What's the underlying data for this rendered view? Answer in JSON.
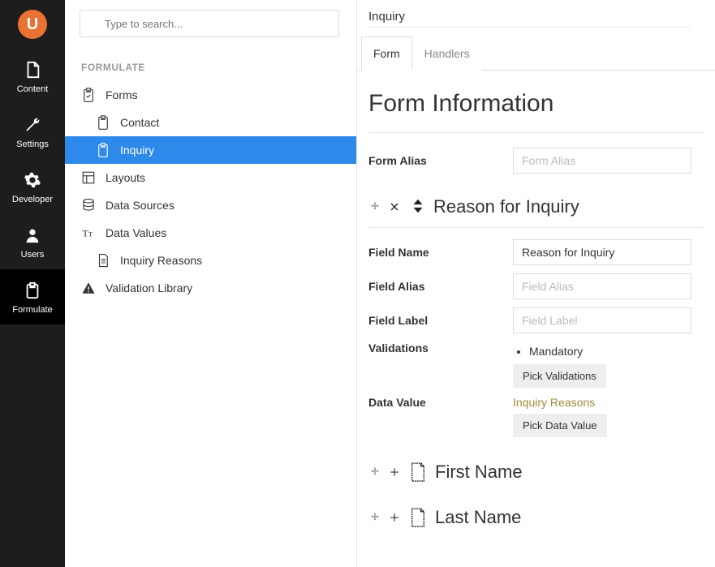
{
  "sidebar": {
    "items": [
      {
        "label": "Content"
      },
      {
        "label": "Settings"
      },
      {
        "label": "Developer"
      },
      {
        "label": "Users"
      },
      {
        "label": "Formulate"
      }
    ]
  },
  "search": {
    "placeholder": "Type to search..."
  },
  "tree": {
    "header": "FORMULATE",
    "forms": "Forms",
    "contact": "Contact",
    "inquiry": "Inquiry",
    "layouts": "Layouts",
    "data_sources": "Data Sources",
    "data_values": "Data Values",
    "inquiry_reasons": "Inquiry Reasons",
    "validation_library": "Validation Library"
  },
  "main": {
    "title_value": "Inquiry",
    "tabs": {
      "form": "Form",
      "handlers": "Handlers"
    },
    "section_title": "Form Information",
    "form_alias_label": "Form Alias",
    "form_alias_placeholder": "Form Alias",
    "block1": {
      "title": "Reason for Inquiry",
      "field_name_label": "Field Name",
      "field_name_value": "Reason for Inquiry",
      "field_alias_label": "Field Alias",
      "field_alias_placeholder": "Field Alias",
      "field_label_label": "Field Label",
      "field_label_placeholder": "Field Label",
      "validations_label": "Validations",
      "validation_item": "Mandatory",
      "pick_validations": "Pick Validations",
      "data_value_label": "Data Value",
      "data_value_text": "Inquiry Reasons",
      "pick_data_value": "Pick Data Value"
    },
    "block2": {
      "title": "First Name"
    },
    "block3": {
      "title": "Last Name"
    }
  }
}
